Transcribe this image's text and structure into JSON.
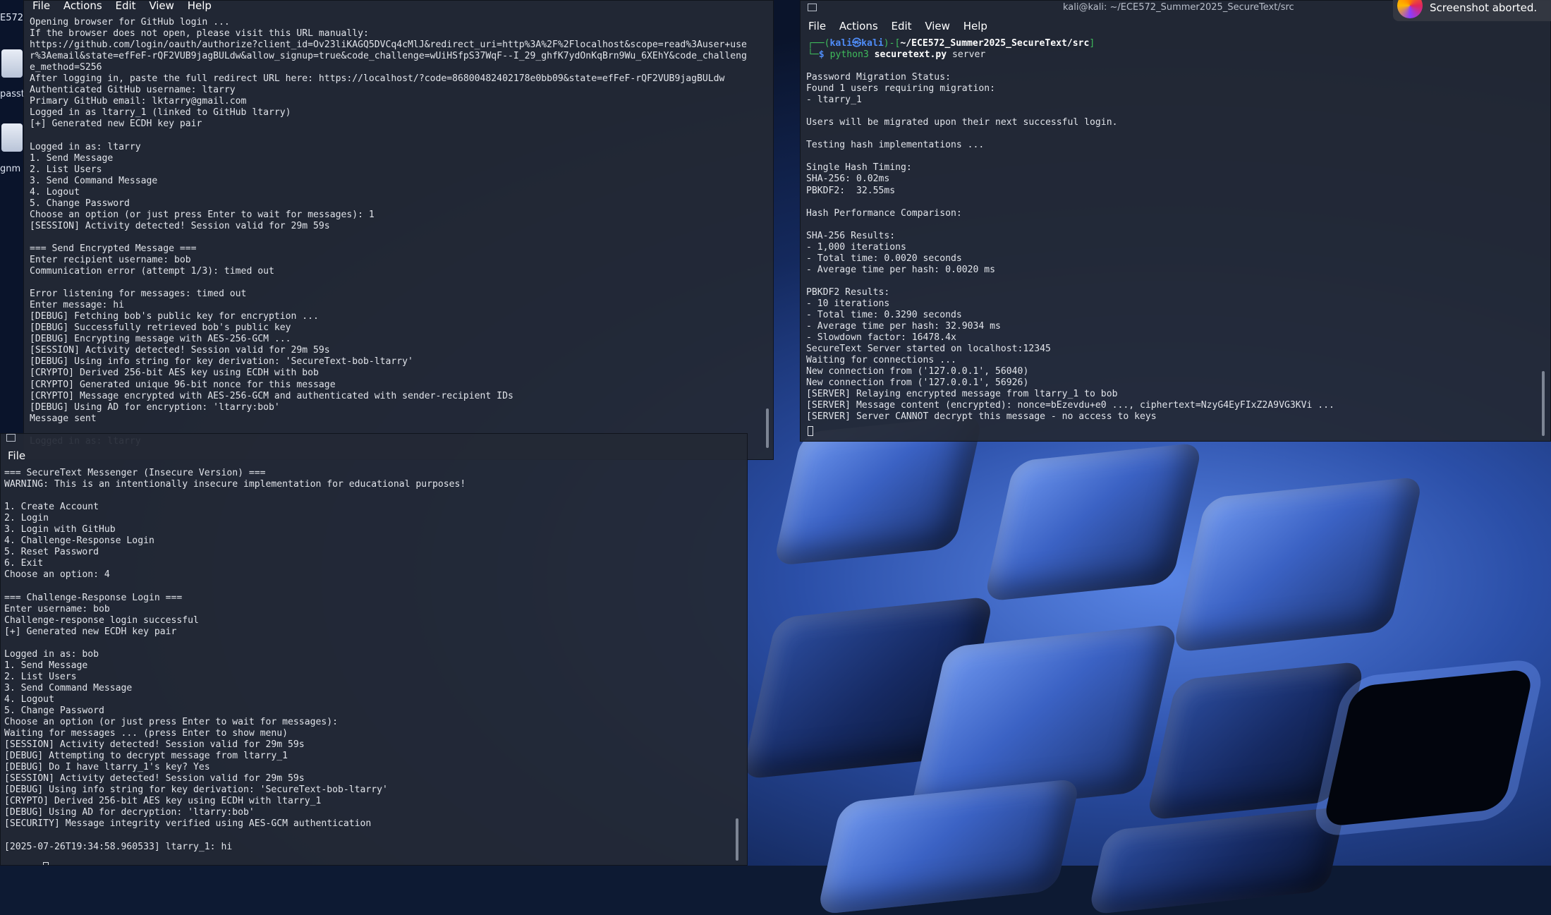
{
  "menu": [
    "File",
    "Actions",
    "Edit",
    "View",
    "Help"
  ],
  "desktop": {
    "icon_labels": [
      "E572",
      "passt",
      "gnm"
    ]
  },
  "server_window": {
    "title": "kali@kali: ~/ECE572_Summer2025_SecureText/src",
    "prompt": {
      "user_host": "kali㉿kali",
      "path": "~/ECE572_Summer2025_SecureText/src",
      "symbol": "$",
      "cmd_a": "python3",
      "cmd_b": "securetext.py",
      "cmd_c": "server"
    },
    "lines": [
      "",
      "Password Migration Status:",
      "Found 1 users requiring migration:",
      "- ltarry_1",
      "",
      "Users will be migrated upon their next successful login.",
      "",
      "Testing hash implementations ...",
      "",
      "Single Hash Timing:",
      "SHA-256: 0.02ms",
      "PBKDF2:  32.55ms",
      "",
      "Hash Performance Comparison:",
      "",
      "SHA-256 Results:",
      "- 1,000 iterations",
      "- Total time: 0.0020 seconds",
      "- Average time per hash: 0.0020 ms",
      "",
      "PBKDF2 Results:",
      "- 10 iterations",
      "- Total time: 0.3290 seconds",
      "- Average time per hash: 32.9034 ms",
      "- Slowdown factor: 16478.4x",
      "SecureText Server started on localhost:12345",
      "Waiting for connections ...",
      "New connection from ('127.0.0.1', 56040)",
      "New connection from ('127.0.0.1', 56926)",
      "[SERVER] Relaying encrypted message from ltarry_1 to bob",
      "[SERVER] Message content (encrypted): nonce=bEzevdu+e0 ..., ciphertext=NzyG4EyFIxZ2A9VG3KVi ...",
      "[SERVER] Server CANNOT decrypt this message - no access to keys"
    ]
  },
  "notification": {
    "text": "Screenshot aborted."
  },
  "ltarry_window": {
    "lines": [
      "Opening browser for GitHub login ...",
      "If the browser does not open, please visit this URL manually:",
      "https://github.com/login/oauth/authorize?client_id=Ov23liKAGQ5DVCq4cMlJ&redirect_uri=http%3A%2F%2Flocalhost&scope=read%3Auser+use",
      "r%3Aemail&state=efFeF-rQF2VUB9jagBULdw&allow_signup=true&code_challenge=wUiHSfpS37WqF--I_29_ghfK7ydOnKqBrn9Wu_6XEhY&code_challeng",
      "e_method=S256",
      "After logging in, paste the full redirect URL here: https://localhost/?code=86800482402178e0bb09&state=efFeF-rQF2VUB9jagBULdw",
      "Authenticated GitHub username: ltarry",
      "Primary GitHub email: lktarry@gmail.com",
      "Logged in as ltarry_1 (linked to GitHub ltarry)",
      "[+] Generated new ECDH key pair",
      "",
      "Logged in as: ltarry",
      "1. Send Message",
      "2. List Users",
      "3. Send Command Message",
      "4. Logout",
      "5. Change Password",
      "Choose an option (or just press Enter to wait for messages): 1",
      "[SESSION] Activity detected! Session valid for 29m 59s",
      "",
      "=== Send Encrypted Message ===",
      "Enter recipient username: bob",
      "Communication error (attempt 1/3): timed out",
      "",
      "Error listening for messages: timed out",
      "Enter message: hi",
      "[DEBUG] Fetching bob's public key for encryption ...",
      "[DEBUG] Successfully retrieved bob's public key",
      "[DEBUG] Encrypting message with AES-256-GCM ...",
      "[SESSION] Activity detected! Session valid for 29m 59s",
      "[DEBUG] Using info string for key derivation: 'SecureText-bob-ltarry'",
      "[CRYPTO] Derived 256-bit AES key using ECDH with bob",
      "[CRYPTO] Generated unique 96-bit nonce for this message",
      "[CRYPTO] Message encrypted with AES-256-GCM and authenticated with sender-recipient IDs",
      "[DEBUG] Using AD for encryption: 'ltarry:bob'",
      "Message sent",
      "",
      "Logged in as: ltarry"
    ]
  },
  "bob_window": {
    "lines": [
      "=== SecureText Messenger (Insecure Version) ===",
      "WARNING: This is an intentionally insecure implementation for educational purposes!",
      "",
      "1. Create Account",
      "2. Login",
      "3. Login with GitHub",
      "4. Challenge-Response Login",
      "5. Reset Password",
      "6. Exit",
      "Choose an option: 4",
      "",
      "=== Challenge-Response Login ===",
      "Enter username: bob",
      "Challenge-response login successful",
      "[+] Generated new ECDH key pair",
      "",
      "Logged in as: bob",
      "1. Send Message",
      "2. List Users",
      "3. Send Command Message",
      "4. Logout",
      "5. Change Password",
      "Choose an option (or just press Enter to wait for messages):",
      "Waiting for messages ... (press Enter to show menu)",
      "[SESSION] Activity detected! Session valid for 29m 59s",
      "[DEBUG] Attempting to decrypt message from ltarry_1",
      "[DEBUG] Do I have ltarry_1's key? Yes",
      "[SESSION] Activity detected! Session valid for 29m 59s",
      "[DEBUG] Using info string for key derivation: 'SecureText-bob-ltarry'",
      "[CRYPTO] Derived 256-bit AES key using ECDH with ltarry_1",
      "[DEBUG] Using AD for decryption: 'ltarry:bob'",
      "[SECURITY] Message integrity verified using AES-GCM authentication",
      "",
      "[2025-07-26T19:34:58.960533] ltarry_1: hi"
    ],
    "input_prompt": ">> "
  }
}
